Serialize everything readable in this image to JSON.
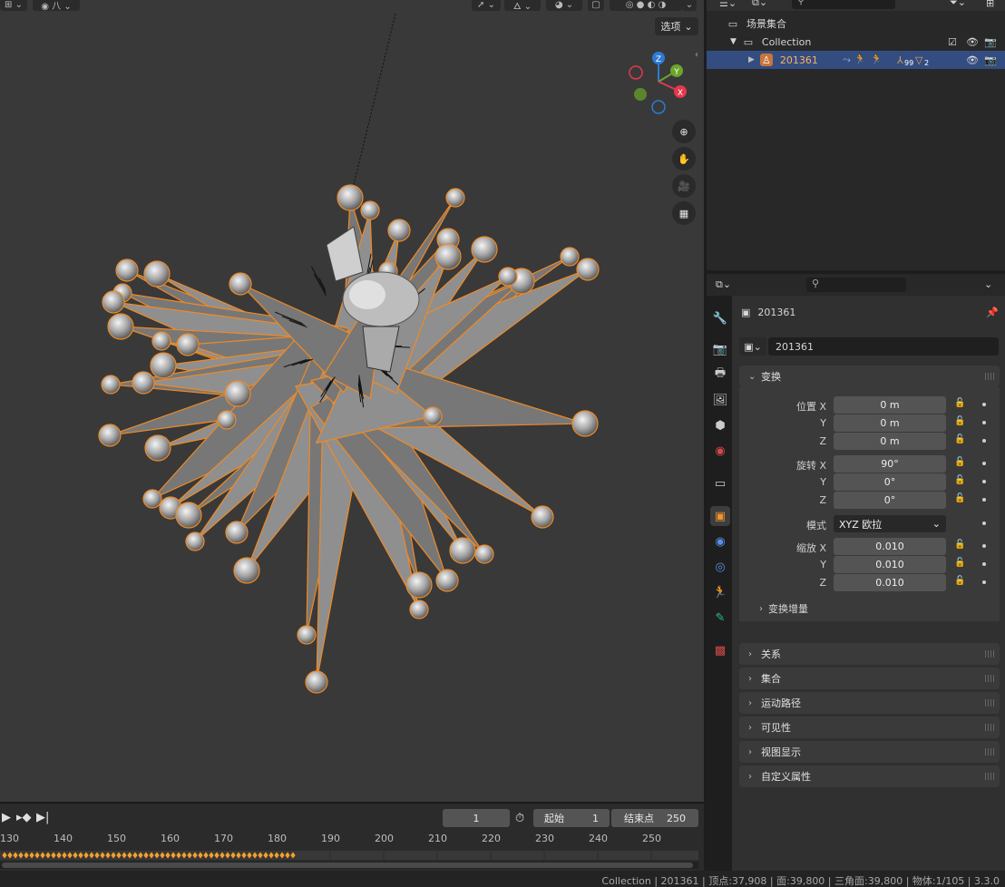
{
  "viewport": {
    "options_label": "选项",
    "gizmo": {
      "x": "X",
      "y": "Y",
      "z": "Z"
    },
    "nav_tools": [
      "zoom-icon",
      "hand-icon",
      "camera-icon",
      "grid-icon"
    ]
  },
  "timeline": {
    "current_frame": "1",
    "start_label": "起始",
    "start_value": "1",
    "end_label": "结束点",
    "end_value": "250",
    "ticks": [
      "130",
      "140",
      "150",
      "160",
      "170",
      "180",
      "190",
      "200",
      "210",
      "220",
      "230",
      "240",
      "250"
    ]
  },
  "outliner": {
    "scene_collection": "场景集合",
    "collection": "Collection",
    "object": "201361",
    "modifier_badges": [
      "99",
      "2"
    ]
  },
  "properties": {
    "object_name": "201361",
    "datablock_name": "201361",
    "transform_panel": "变换",
    "location_label": "位置 X",
    "rotation_label": "旋转 X",
    "scale_label": "缩放 X",
    "mode_label": "模式",
    "axis_y": "Y",
    "axis_z": "Z",
    "location": [
      "0 m",
      "0 m",
      "0 m"
    ],
    "rotation": [
      "90°",
      "0°",
      "0°"
    ],
    "mode_value": "XYZ 欧拉",
    "scale": [
      "0.010",
      "0.010",
      "0.010"
    ],
    "delta_transform": "变换增量",
    "panels": [
      "关系",
      "集合",
      "运动路径",
      "可见性",
      "视图显示",
      "自定义属性"
    ]
  },
  "status": {
    "text": "Collection | 201361 | 顶点:37,908 | 面:39,800 | 三角面:39,800 | 物体:1/105 | 3.3.0"
  },
  "colors": {
    "accent": "#fbb163",
    "selection": "#334d80",
    "outline": "#f08a24",
    "gizmo_x": "#e3384e",
    "gizmo_y": "#6aa629",
    "gizmo_z": "#2d7ad4"
  }
}
